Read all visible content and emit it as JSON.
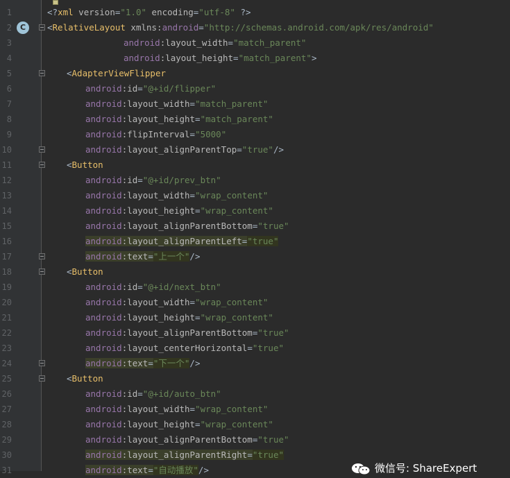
{
  "editor": {
    "lines": [
      {
        "n": "1",
        "indent": 68,
        "tokens": [
          [
            "pun",
            "<?"
          ],
          [
            "tag",
            "xml "
          ],
          [
            "attr",
            "version"
          ],
          [
            "pun",
            "="
          ],
          [
            "val",
            "\"1.0\""
          ],
          [
            "attr",
            " encoding"
          ],
          [
            "pun",
            "="
          ],
          [
            "val",
            "\"utf-8\""
          ],
          [
            "pun",
            " ?>"
          ]
        ]
      },
      {
        "n": "2",
        "indent": 68,
        "marker": "C",
        "fold": "open",
        "tokens": [
          [
            "pun",
            "<"
          ],
          [
            "tag",
            "RelativeLayout "
          ],
          [
            "attr",
            "xmlns:"
          ],
          [
            "ns",
            "android"
          ],
          [
            "pun",
            "="
          ],
          [
            "val",
            "\"http://schemas.android.com/apk/res/android\""
          ]
        ]
      },
      {
        "n": "3",
        "indent": 178,
        "tokens": [
          [
            "ns",
            "android"
          ],
          [
            "attr",
            ":layout_width"
          ],
          [
            "pun",
            "="
          ],
          [
            "val",
            "\"match_parent\""
          ]
        ]
      },
      {
        "n": "4",
        "indent": 178,
        "tokens": [
          [
            "ns",
            "android"
          ],
          [
            "attr",
            ":layout_height"
          ],
          [
            "pun",
            "="
          ],
          [
            "val",
            "\"match_parent\""
          ],
          [
            "pun",
            ">"
          ]
        ]
      },
      {
        "n": "5",
        "indent": 96,
        "fold": "open",
        "tokens": [
          [
            "pun",
            "<"
          ],
          [
            "tag",
            "AdapterViewFlipper"
          ]
        ]
      },
      {
        "n": "6",
        "indent": 123,
        "tokens": [
          [
            "ns",
            "android"
          ],
          [
            "attr",
            ":id"
          ],
          [
            "pun",
            "="
          ],
          [
            "val",
            "\"@+id/flipper\""
          ]
        ]
      },
      {
        "n": "7",
        "indent": 123,
        "tokens": [
          [
            "ns",
            "android"
          ],
          [
            "attr",
            ":layout_width"
          ],
          [
            "pun",
            "="
          ],
          [
            "val",
            "\"match_parent\""
          ]
        ]
      },
      {
        "n": "8",
        "indent": 123,
        "tokens": [
          [
            "ns",
            "android"
          ],
          [
            "attr",
            ":layout_height"
          ],
          [
            "pun",
            "="
          ],
          [
            "val",
            "\"match_parent\""
          ]
        ]
      },
      {
        "n": "9",
        "indent": 123,
        "tokens": [
          [
            "ns",
            "android"
          ],
          [
            "attr",
            ":flipInterval"
          ],
          [
            "pun",
            "="
          ],
          [
            "val",
            "\"5000\""
          ]
        ]
      },
      {
        "n": "10",
        "indent": 123,
        "fold": "end",
        "tokens": [
          [
            "ns",
            "android"
          ],
          [
            "attr",
            ":layout_alignParentTop"
          ],
          [
            "pun",
            "="
          ],
          [
            "val",
            "\"true\""
          ],
          [
            "pun",
            "/>"
          ]
        ]
      },
      {
        "n": "11",
        "indent": 96,
        "fold": "open",
        "tokens": [
          [
            "pun",
            "<"
          ],
          [
            "tag",
            "Button"
          ]
        ]
      },
      {
        "n": "12",
        "indent": 123,
        "tokens": [
          [
            "ns",
            "android"
          ],
          [
            "attr",
            ":id"
          ],
          [
            "pun",
            "="
          ],
          [
            "val",
            "\"@+id/prev_btn\""
          ]
        ]
      },
      {
        "n": "13",
        "indent": 123,
        "tokens": [
          [
            "ns",
            "android"
          ],
          [
            "attr",
            ":layout_width"
          ],
          [
            "pun",
            "="
          ],
          [
            "val",
            "\"wrap_content\""
          ]
        ]
      },
      {
        "n": "14",
        "indent": 123,
        "tokens": [
          [
            "ns",
            "android"
          ],
          [
            "attr",
            ":layout_height"
          ],
          [
            "pun",
            "="
          ],
          [
            "val",
            "\"wrap_content\""
          ]
        ]
      },
      {
        "n": "15",
        "indent": 123,
        "tokens": [
          [
            "ns",
            "android"
          ],
          [
            "attr",
            ":layout_alignParentBottom"
          ],
          [
            "pun",
            "="
          ],
          [
            "val",
            "\"true\""
          ]
        ]
      },
      {
        "n": "16",
        "indent": 123,
        "hl": true,
        "tokens": [
          [
            "ns",
            "android"
          ],
          [
            "attr",
            ":layout_alignParentLeft"
          ],
          [
            "pun",
            "="
          ],
          [
            "val",
            "\"true\""
          ]
        ]
      },
      {
        "n": "17",
        "indent": 123,
        "hl": true,
        "fold": "end",
        "tokens": [
          [
            "ns",
            "android"
          ],
          [
            "attr",
            ":text"
          ],
          [
            "pun",
            "="
          ],
          [
            "val",
            "\"上一个\""
          ],
          [
            "pun",
            "/>"
          ]
        ]
      },
      {
        "n": "18",
        "indent": 96,
        "fold": "open",
        "tokens": [
          [
            "pun",
            "<"
          ],
          [
            "tag",
            "Button"
          ]
        ]
      },
      {
        "n": "19",
        "indent": 123,
        "tokens": [
          [
            "ns",
            "android"
          ],
          [
            "attr",
            ":id"
          ],
          [
            "pun",
            "="
          ],
          [
            "val",
            "\"@+id/next_btn\""
          ]
        ]
      },
      {
        "n": "20",
        "indent": 123,
        "tokens": [
          [
            "ns",
            "android"
          ],
          [
            "attr",
            ":layout_width"
          ],
          [
            "pun",
            "="
          ],
          [
            "val",
            "\"wrap_content\""
          ]
        ]
      },
      {
        "n": "21",
        "indent": 123,
        "tokens": [
          [
            "ns",
            "android"
          ],
          [
            "attr",
            ":layout_height"
          ],
          [
            "pun",
            "="
          ],
          [
            "val",
            "\"wrap_content\""
          ]
        ]
      },
      {
        "n": "22",
        "indent": 123,
        "tokens": [
          [
            "ns",
            "android"
          ],
          [
            "attr",
            ":layout_alignParentBottom"
          ],
          [
            "pun",
            "="
          ],
          [
            "val",
            "\"true\""
          ]
        ]
      },
      {
        "n": "23",
        "indent": 123,
        "tokens": [
          [
            "ns",
            "android"
          ],
          [
            "attr",
            ":layout_centerHorizontal"
          ],
          [
            "pun",
            "="
          ],
          [
            "val",
            "\"true\""
          ]
        ]
      },
      {
        "n": "24",
        "indent": 123,
        "hl": true,
        "fold": "end",
        "tokens": [
          [
            "ns",
            "android"
          ],
          [
            "attr",
            ":text"
          ],
          [
            "pun",
            "="
          ],
          [
            "val",
            "\"下一个\""
          ],
          [
            "pun",
            "/>"
          ]
        ]
      },
      {
        "n": "25",
        "indent": 96,
        "fold": "open",
        "tokens": [
          [
            "pun",
            "<"
          ],
          [
            "tag",
            "Button"
          ]
        ]
      },
      {
        "n": "26",
        "indent": 123,
        "tokens": [
          [
            "ns",
            "android"
          ],
          [
            "attr",
            ":id"
          ],
          [
            "pun",
            "="
          ],
          [
            "val",
            "\"@+id/auto_btn\""
          ]
        ]
      },
      {
        "n": "27",
        "indent": 123,
        "tokens": [
          [
            "ns",
            "android"
          ],
          [
            "attr",
            ":layout_width"
          ],
          [
            "pun",
            "="
          ],
          [
            "val",
            "\"wrap_content\""
          ]
        ]
      },
      {
        "n": "28",
        "indent": 123,
        "tokens": [
          [
            "ns",
            "android"
          ],
          [
            "attr",
            ":layout_height"
          ],
          [
            "pun",
            "="
          ],
          [
            "val",
            "\"wrap_content\""
          ]
        ]
      },
      {
        "n": "29",
        "indent": 123,
        "tokens": [
          [
            "ns",
            "android"
          ],
          [
            "attr",
            ":layout_alignParentBottom"
          ],
          [
            "pun",
            "="
          ],
          [
            "val",
            "\"true\""
          ]
        ]
      },
      {
        "n": "30",
        "indent": 123,
        "hl": true,
        "tokens": [
          [
            "ns",
            "android"
          ],
          [
            "attr",
            ":layout_alignParentRight"
          ],
          [
            "pun",
            "="
          ],
          [
            "val",
            "\"true\""
          ]
        ]
      },
      {
        "n": "31",
        "indent": 123,
        "hl": true,
        "tokens": [
          [
            "ns",
            "android"
          ],
          [
            "attr",
            ":text"
          ],
          [
            "pun",
            "="
          ],
          [
            "val",
            "\"自动播放\""
          ],
          [
            "pun",
            "/>"
          ]
        ]
      }
    ]
  },
  "watermark": {
    "text": "微信号: ShareExpert",
    "icon": "wechat-icon"
  },
  "colors": {
    "background": "#2b2b2b",
    "gutter": "#313335",
    "tag": "#e8bf6a",
    "namespace": "#9876aa",
    "attribute": "#bababa",
    "value": "#6a8759",
    "marker": "#9fc4d8"
  }
}
